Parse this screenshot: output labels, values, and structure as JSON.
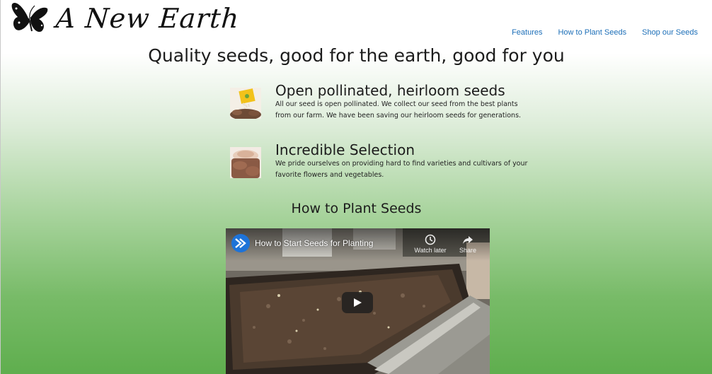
{
  "brand": {
    "name": "A New Earth",
    "logo_icon": "butterfly-icon"
  },
  "nav": {
    "items": [
      {
        "label": "Features"
      },
      {
        "label": "How to Plant Seeds"
      },
      {
        "label": "Shop our Seeds"
      }
    ]
  },
  "hero": {
    "tagline": "Quality seeds, good for the earth, good for you"
  },
  "features": [
    {
      "icon": "seed-packet-icon",
      "title": "Open pollinated, heirloom seeds",
      "text": "All our seed is open pollinated. We collect our seed from the best plants from our farm. We have been saving our heirloom seeds for generations."
    },
    {
      "icon": "soil-hands-icon",
      "title": "Incredible Selection",
      "text": "We pride ourselves on providing hard to find varieties and cultivars of your favorite flowers and vegetables."
    }
  ],
  "how_to": {
    "title": "How to Plant Seeds"
  },
  "video": {
    "title": "How to Start Seeds for Planting",
    "watch_later_label": "Watch later",
    "share_label": "Share",
    "channel_icon": "channel-arrow-icon",
    "play_icon": "play-icon",
    "clock_icon": "clock-icon",
    "share_icon": "share-arrow-icon"
  }
}
